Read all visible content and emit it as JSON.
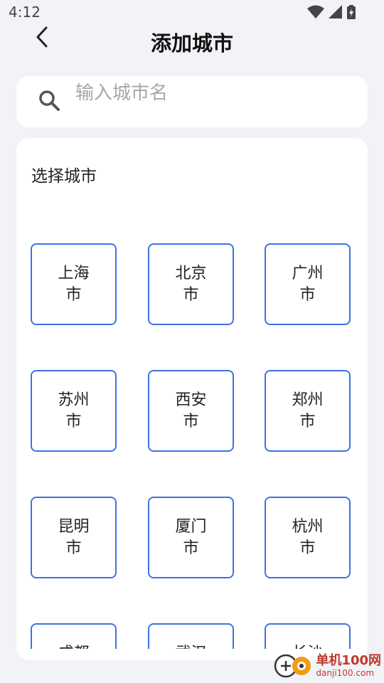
{
  "status_bar": {
    "time": "4:12",
    "icons": [
      "wifi-icon",
      "signal-icon",
      "battery-icon"
    ]
  },
  "header": {
    "title": "添加城市",
    "back_icon": "chevron-left-icon"
  },
  "search": {
    "placeholder": "输入城市名",
    "value": "",
    "icon": "search-icon"
  },
  "section": {
    "title": "选择城市"
  },
  "cities": [
    "上海市",
    "北京市",
    "广州市",
    "苏州市",
    "西安市",
    "郑州市",
    "昆明市",
    "厦门市",
    "杭州市",
    "成都市",
    "武汉市",
    "长沙市"
  ],
  "watermark": {
    "main": "单机100网",
    "sub": "danji100.com"
  },
  "colors": {
    "accent": "#3f72e0",
    "background": "#f2f3f7",
    "card": "#ffffff"
  }
}
